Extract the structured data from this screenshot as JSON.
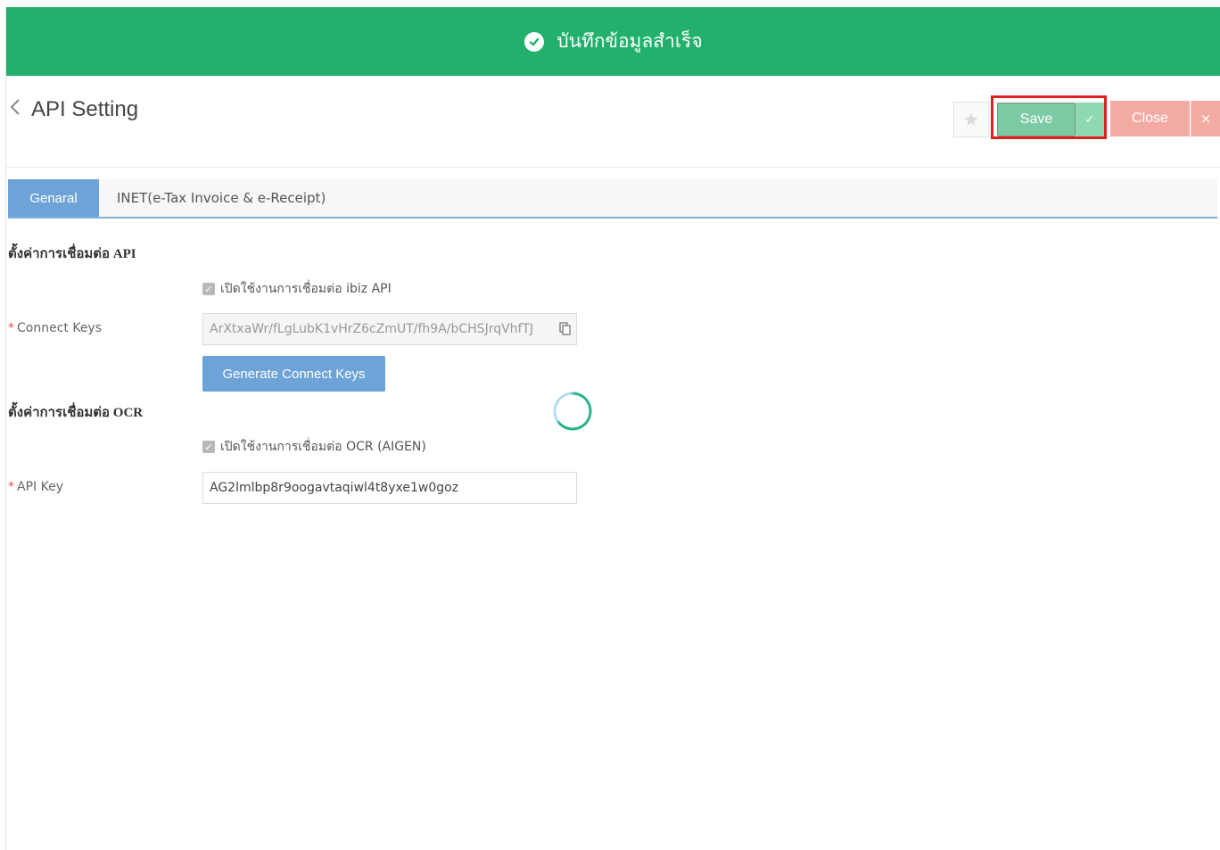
{
  "toast": {
    "message": "บันทึกข้อมูลสำเร็จ",
    "icon": "check-circle-icon",
    "color": "#22b06c"
  },
  "header": {
    "title": "API Setting"
  },
  "toolbar": {
    "save_label": "Save",
    "close_label": "Close",
    "close_x": "×",
    "check": "✓"
  },
  "tabs": [
    {
      "label": "Genaral",
      "active": true
    },
    {
      "label": "INET(e-Tax Invoice & e-Receipt)",
      "active": false
    }
  ],
  "api_section": {
    "title": "ตั้งค่าการเชื่อมต่อ API",
    "enable_label": "เปิดใช้งานการเชื่อมต่อ ibiz API",
    "enabled": true,
    "connect_keys_label": "Connect Keys",
    "connect_keys_value": "ArXtxaWr/fLgLubK1vHrZ6cZmUT/fh9A/bCHSJrqVhfTJ",
    "generate_label": "Generate Connect Keys"
  },
  "ocr_section": {
    "title": "ตั้งค่าการเชื่อมต่อ OCR",
    "enable_label": "เปิดใช้งานการเชื่อมต่อ OCR (AIGEN)",
    "enabled": true,
    "api_key_label": "API Key",
    "api_key_value": "AG2lmlbp8r9oogavtaqiwl4t8yxe1w0goz"
  },
  "required_marker": "*",
  "colors": {
    "accent": "#6da3d6",
    "save": "#7ccaa3",
    "close": "#f3aaa3",
    "highlight": "#e02020"
  }
}
